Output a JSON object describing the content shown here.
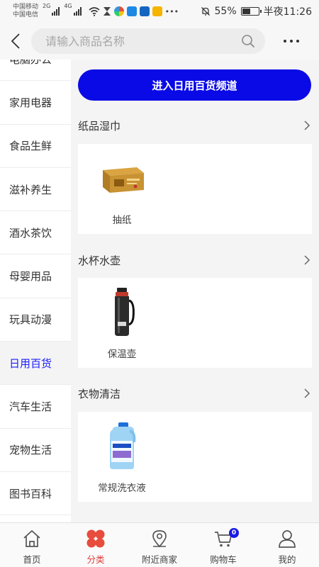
{
  "status_bar": {
    "carrier_1": "中国移动",
    "carrier_2": "中国电信",
    "net_1": "2G",
    "net_2": "4G",
    "battery_percent": "55%",
    "battery_level": 0.55,
    "time": "半夜11:26"
  },
  "search": {
    "placeholder": "请输入商品名称"
  },
  "sidebar": {
    "items": [
      {
        "label": "电脑办公",
        "active": false
      },
      {
        "label": "家用电器",
        "active": false
      },
      {
        "label": "食品生鲜",
        "active": false
      },
      {
        "label": "滋补养生",
        "active": false
      },
      {
        "label": "酒水茶饮",
        "active": false
      },
      {
        "label": "母婴用品",
        "active": false
      },
      {
        "label": "玩具动漫",
        "active": false
      },
      {
        "label": "日用百货",
        "active": true
      },
      {
        "label": "汽车生活",
        "active": false
      },
      {
        "label": "宠物生活",
        "active": false
      },
      {
        "label": "图书百科",
        "active": false
      }
    ]
  },
  "main": {
    "channel_button": "进入日用百货频道",
    "categories": [
      {
        "title": "纸品湿巾",
        "products": [
          {
            "name": "抽纸",
            "icon": "tissue-box-icon"
          }
        ]
      },
      {
        "title": "水杯水壶",
        "products": [
          {
            "name": "保温壶",
            "icon": "thermos-icon"
          }
        ]
      },
      {
        "title": "衣物清洁",
        "products": [
          {
            "name": "常规洗衣液",
            "icon": "laundry-detergent-icon"
          }
        ]
      }
    ]
  },
  "tabbar": {
    "tabs": [
      {
        "label": "首页",
        "icon": "home-icon",
        "active": false
      },
      {
        "label": "分类",
        "icon": "category-icon",
        "active": true
      },
      {
        "label": "附近商家",
        "icon": "location-pin-icon",
        "active": false
      },
      {
        "label": "购物车",
        "icon": "cart-icon",
        "active": false,
        "badge": "0"
      },
      {
        "label": "我的",
        "icon": "user-icon",
        "active": false
      }
    ]
  },
  "colors": {
    "accent_blue": "#0a0ae6",
    "active_sidebar_text": "#1a1aff",
    "active_tab": "#e23b3b"
  }
}
